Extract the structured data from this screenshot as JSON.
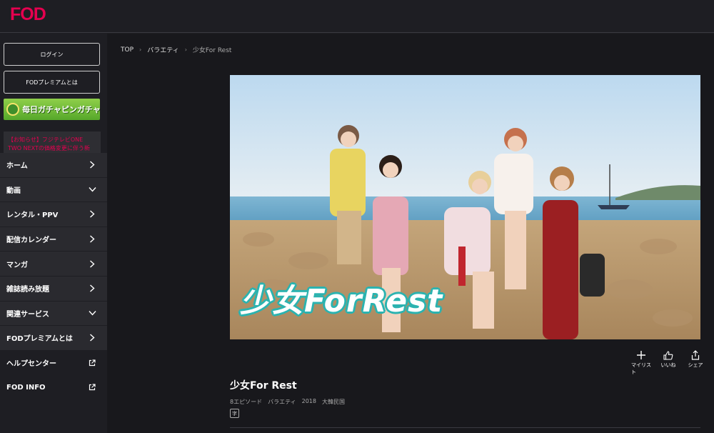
{
  "header": {
    "logo": "FOD"
  },
  "sidebar": {
    "login": "ログイン",
    "premium_about": "FODプレミアムとは",
    "banner_text": "毎日ガチャピンガチャ",
    "notice": "【お知らせ】フジテレビONE TWO NEXTの価格変更に伴う新規・再入会キャンペーンについて",
    "nav": [
      {
        "label": "ホーム",
        "icon": "chevron-right"
      },
      {
        "label": "動画",
        "icon": "chevron-down"
      },
      {
        "label": "レンタル・PPV",
        "icon": "chevron-right"
      },
      {
        "label": "配信カレンダー",
        "icon": "chevron-right"
      },
      {
        "label": "マンガ",
        "icon": "chevron-right"
      },
      {
        "label": "雑誌読み放題",
        "icon": "chevron-right"
      },
      {
        "label": "関連サービス",
        "icon": "chevron-down"
      },
      {
        "label": "FODプレミアムとは",
        "icon": "chevron-right"
      },
      {
        "label": "ヘルプセンター",
        "icon": "external-link"
      },
      {
        "label": "FOD INFO",
        "icon": "external-link"
      }
    ]
  },
  "breadcrumb": {
    "top": "TOP",
    "category": "バラエティ",
    "current": "少女For Rest"
  },
  "hero": {
    "title_overlay": "少女ForRest"
  },
  "actions": {
    "mylist": "マイリスト",
    "like": "いいね",
    "share": "シェア"
  },
  "program": {
    "title": "少女For Rest",
    "episodes": "8エピソード",
    "genre": "バラエティ",
    "year": "2018",
    "country": "大韓民国",
    "subtitle_badge": "字"
  },
  "colors": {
    "brand": "#e5004f",
    "teal_outline": "#2bb3b0"
  }
}
